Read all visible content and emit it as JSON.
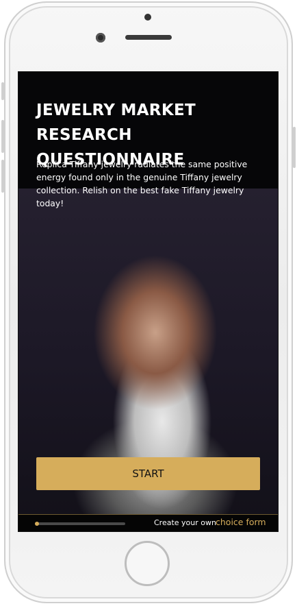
{
  "survey": {
    "title_line1": "JEWELRY MARKET",
    "title_line2": "RESEARCH QUESTIONNAIRE",
    "description": "Replica Tiffany jewelry radiates the same positive energy found only in the genuine Tiffany jewelry collection. Relish on the best fake Tiffany jewelry today!",
    "start_label": "START"
  },
  "footer": {
    "progress": 0.05,
    "create_text": "Create your own",
    "link_text": "choice form"
  },
  "colors": {
    "accent": "#d6ad5b",
    "background": "#060608",
    "text": "#ffffff"
  }
}
